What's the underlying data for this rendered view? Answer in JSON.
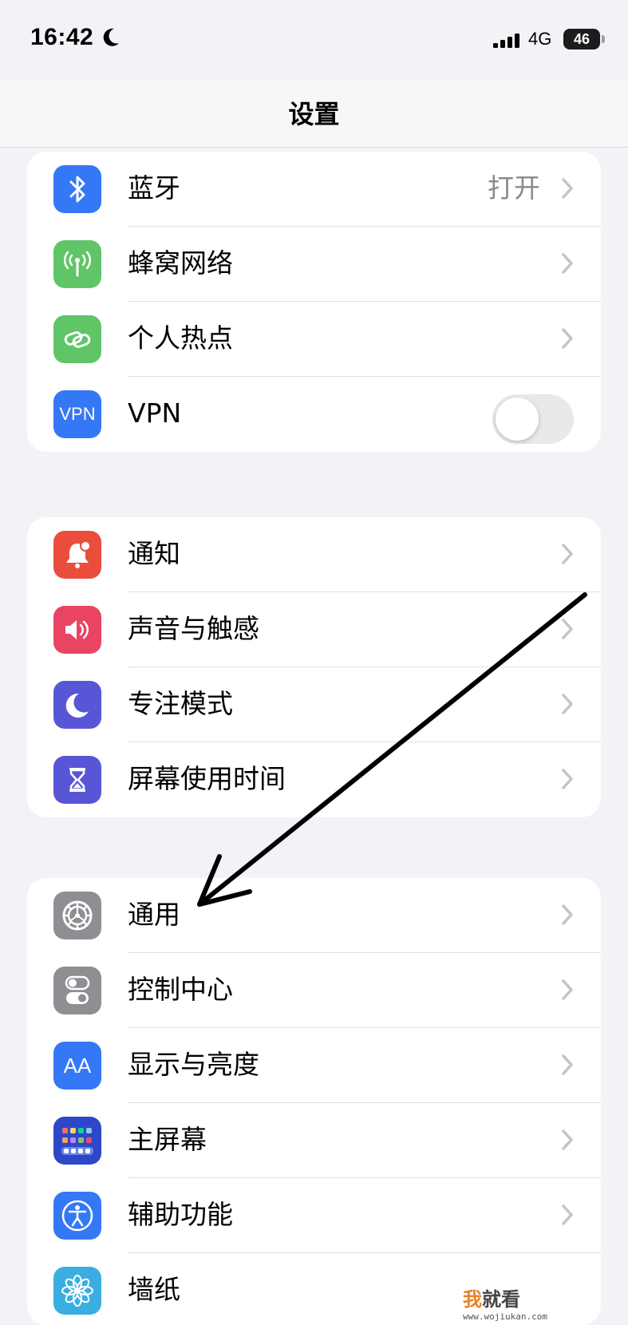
{
  "status_bar": {
    "time": "16:42",
    "network": "4G",
    "battery": "46"
  },
  "nav": {
    "title": "设置"
  },
  "group1": [
    {
      "label": "蓝牙",
      "value": "打开",
      "icon": "bluetooth-icon",
      "color": "#3478f6"
    },
    {
      "label": "蜂窝网络",
      "icon": "antenna-icon",
      "color": "#5fc566"
    },
    {
      "label": "个人热点",
      "icon": "link-icon",
      "color": "#5fc566"
    },
    {
      "label": "VPN",
      "icon_text": "VPN",
      "icon": "vpn-icon",
      "color": "#3478f6",
      "toggle_on": false
    }
  ],
  "group2": [
    {
      "label": "通知",
      "icon": "bell-icon",
      "color": "#eb4d3d"
    },
    {
      "label": "声音与触感",
      "icon": "speaker-icon",
      "color": "#ea4463"
    },
    {
      "label": "专注模式",
      "icon": "moon-icon",
      "color": "#5856d6"
    },
    {
      "label": "屏幕使用时间",
      "icon": "hourglass-icon",
      "color": "#5856d6"
    }
  ],
  "group3": [
    {
      "label": "通用",
      "icon": "gear-icon",
      "color": "#8e8e93"
    },
    {
      "label": "控制中心",
      "icon": "switches-icon",
      "color": "#8e8e93"
    },
    {
      "label": "显示与亮度",
      "icon_text": "AA",
      "icon": "text-size-icon",
      "color": "#3478f6"
    },
    {
      "label": "主屏幕",
      "icon": "app-grid-icon",
      "color": "#2c48c8"
    },
    {
      "label": "辅助功能",
      "icon": "accessibility-icon",
      "color": "#3478f6"
    },
    {
      "label": "墙纸",
      "icon": "flower-icon",
      "color": "#3aaee0"
    }
  ],
  "watermark": {
    "brand_1": "我",
    "brand_2": "就看",
    "url": "www.wojiukan.com"
  }
}
